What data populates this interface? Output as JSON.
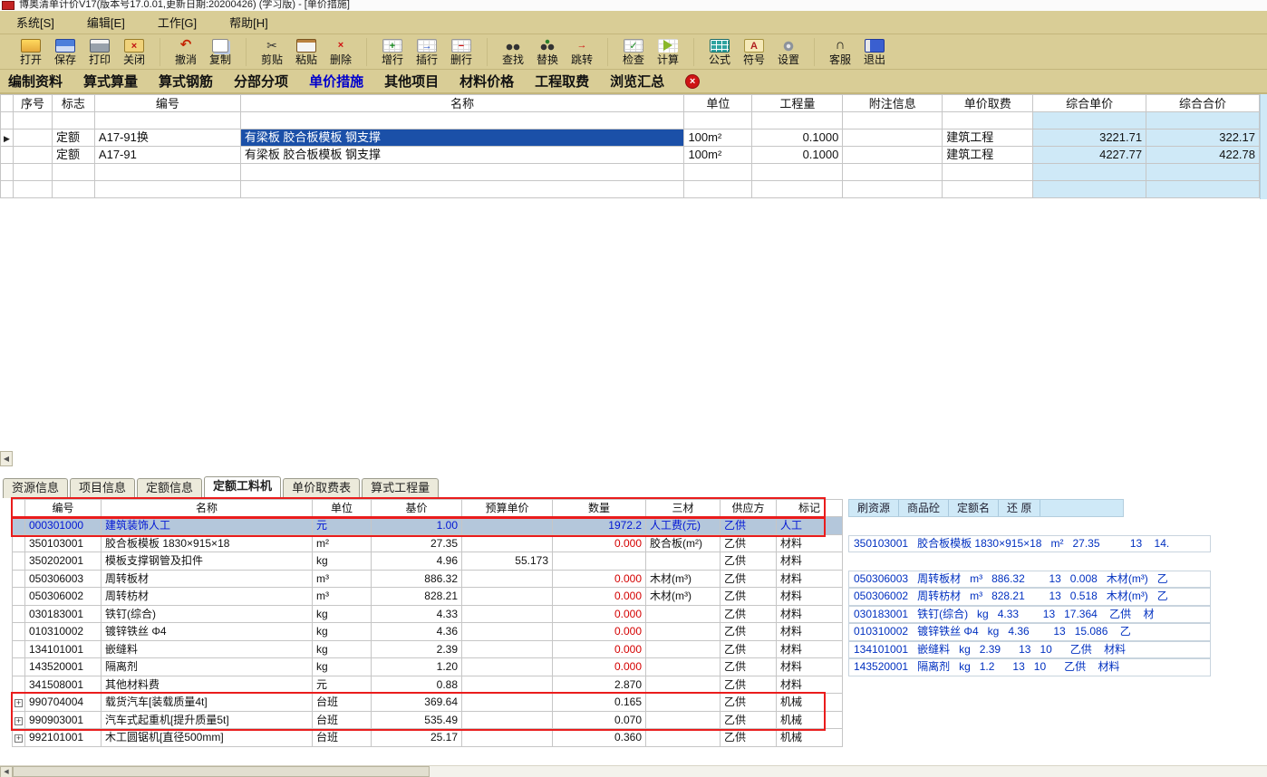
{
  "window": {
    "title": "博奥清单计价V17(版本号17.0.01,更新日期:20200426) (学习版) - [单价措施]"
  },
  "menu_bar": {
    "items": [
      "系统[S]",
      "编辑[E]",
      "工作[G]",
      "帮助[H]"
    ]
  },
  "toolbar": {
    "groups": {
      "file": [
        {
          "label": "打开",
          "icon": "open-folder-icon"
        },
        {
          "label": "保存",
          "icon": "save-floppy-icon"
        },
        {
          "label": "打印",
          "icon": "printer-icon"
        },
        {
          "label": "关闭",
          "icon": "close-door-icon"
        }
      ],
      "edit": [
        {
          "label": "撤消",
          "icon": "undo-arrow-icon"
        },
        {
          "label": "复制",
          "icon": "copy-icon"
        }
      ],
      "clipboard": [
        {
          "label": "剪贴",
          "icon": "scissors-icon"
        },
        {
          "label": "粘贴",
          "icon": "paste-clipboard-icon"
        },
        {
          "label": "删除",
          "icon": "delete-icon"
        }
      ],
      "rows": [
        {
          "label": "增行",
          "icon": "add-row-icon"
        },
        {
          "label": "插行",
          "icon": "insert-row-icon"
        },
        {
          "label": "删行",
          "icon": "delete-row-icon"
        }
      ],
      "search": [
        {
          "label": "查找",
          "icon": "find-icon"
        },
        {
          "label": "替换",
          "icon": "replace-icon"
        },
        {
          "label": "跳转",
          "icon": "goto-icon"
        }
      ],
      "calc": [
        {
          "label": "检查",
          "icon": "check-icon"
        },
        {
          "label": "计算",
          "icon": "calculate-icon"
        }
      ],
      "tools": [
        {
          "label": "公式",
          "icon": "formula-icon"
        },
        {
          "label": "符号",
          "icon": "symbol-icon"
        },
        {
          "label": "设置",
          "icon": "settings-icon"
        }
      ],
      "session": [
        {
          "label": "客服",
          "icon": "support-headset-icon"
        },
        {
          "label": "退出",
          "icon": "exit-icon"
        }
      ]
    }
  },
  "nav_tabs": {
    "items": [
      {
        "label": "编制资料",
        "active": false
      },
      {
        "label": "算式算量",
        "active": false
      },
      {
        "label": "算式钢筋",
        "active": false
      },
      {
        "label": "分部分项",
        "active": false
      },
      {
        "label": "单价措施",
        "active": true
      },
      {
        "label": "其他项目",
        "active": false
      },
      {
        "label": "材料价格",
        "active": false
      },
      {
        "label": "工程取费",
        "active": false
      },
      {
        "label": "浏览汇总",
        "active": false
      }
    ],
    "close_glyph": "×",
    "active_color": "#0000cc"
  },
  "upper_table": {
    "current_row_arrow": "▶",
    "columns": [
      "序号",
      "标志",
      "编号",
      "名称",
      "单位",
      "工程量",
      "附注信息",
      "单价取费",
      "综合单价",
      "综合合价"
    ],
    "highlight_column_color": "#cfe9f7",
    "rows": [
      {
        "seq": "",
        "flag": "",
        "code": "",
        "name": "",
        "unit": "",
        "qty": "",
        "note": "",
        "fee": "",
        "price": "",
        "total": "",
        "current": false,
        "name_selected": false
      },
      {
        "seq": "",
        "flag": "定额",
        "code": "A17-91换",
        "name": "有梁板 胶合板模板 钢支撑",
        "unit": "100m²",
        "qty": "0.1000",
        "note": "",
        "fee": "建筑工程",
        "price": "3221.71",
        "total": "322.17",
        "current": true,
        "name_selected": true
      },
      {
        "seq": "",
        "flag": "定额",
        "code": "A17-91",
        "name": "有梁板 胶合板模板 钢支撑",
        "unit": "100m²",
        "qty": "0.1000",
        "note": "",
        "fee": "建筑工程",
        "price": "4227.77",
        "total": "422.78",
        "current": false,
        "name_selected": false
      },
      {
        "seq": "",
        "flag": "",
        "code": "",
        "name": "",
        "unit": "",
        "qty": "",
        "note": "",
        "fee": "",
        "price": "",
        "total": "",
        "current": false,
        "name_selected": false
      },
      {
        "seq": "",
        "flag": "",
        "code": "",
        "name": "",
        "unit": "",
        "qty": "",
        "note": "",
        "fee": "",
        "price": "",
        "total": "",
        "current": false,
        "name_selected": false
      }
    ]
  },
  "detail_tabs": {
    "items": [
      {
        "label": "资源信息",
        "active": false
      },
      {
        "label": "项目信息",
        "active": false
      },
      {
        "label": "定额信息",
        "active": false
      },
      {
        "label": "定额工料机",
        "active": true
      },
      {
        "label": "单价取费表",
        "active": false
      },
      {
        "label": "算式工程量",
        "active": false
      }
    ]
  },
  "detail_table": {
    "expand_glyph": "+",
    "columns": [
      "编号",
      "名称",
      "单位",
      "基价",
      "预算单价",
      "数量",
      "三材",
      "供应方",
      "标记"
    ],
    "rows": [
      {
        "code": "000301000",
        "name": "建筑装饰人工",
        "unit": "元",
        "base": "1.00",
        "budget": "",
        "qty": "1972.2",
        "material": "人工费(元)",
        "supply": "乙供",
        "mark": "人工",
        "highlight": true,
        "qty_selected": true,
        "qty_red": false,
        "expandable": false
      },
      {
        "code": "350103001",
        "name": "胶合板模板 1830×915×18",
        "unit": "m²",
        "base": "27.35",
        "budget": "",
        "qty": "0.000",
        "material": "胶合板(m²)",
        "supply": "乙供",
        "mark": "材料",
        "highlight": false,
        "qty_selected": false,
        "qty_red": true,
        "expandable": false
      },
      {
        "code": "350202001",
        "name": "模板支撑钢管及扣件",
        "unit": "kg",
        "base": "4.96",
        "budget": "55.173",
        "qty": "",
        "material": "",
        "supply": "乙供",
        "mark": "材料",
        "highlight": false,
        "qty_selected": false,
        "qty_red": false,
        "expandable": false
      },
      {
        "code": "050306003",
        "name": "周转板材",
        "unit": "m³",
        "base": "886.32",
        "budget": "",
        "qty": "0.000",
        "material": "木材(m³)",
        "supply": "乙供",
        "mark": "材料",
        "highlight": false,
        "qty_selected": false,
        "qty_red": true,
        "expandable": false
      },
      {
        "code": "050306002",
        "name": "周转枋材",
        "unit": "m³",
        "base": "828.21",
        "budget": "",
        "qty": "0.000",
        "material": "木材(m³)",
        "supply": "乙供",
        "mark": "材料",
        "highlight": false,
        "qty_selected": false,
        "qty_red": true,
        "expandable": false
      },
      {
        "code": "030183001",
        "name": "铁钉(综合)",
        "unit": "kg",
        "base": "4.33",
        "budget": "",
        "qty": "0.000",
        "material": "",
        "supply": "乙供",
        "mark": "材料",
        "highlight": false,
        "qty_selected": false,
        "qty_red": true,
        "expandable": false
      },
      {
        "code": "010310002",
        "name": "镀锌铁丝 Φ4",
        "unit": "kg",
        "base": "4.36",
        "budget": "",
        "qty": "0.000",
        "material": "",
        "supply": "乙供",
        "mark": "材料",
        "highlight": false,
        "qty_selected": false,
        "qty_red": true,
        "expandable": false
      },
      {
        "code": "134101001",
        "name": "嵌缝料",
        "unit": "kg",
        "base": "2.39",
        "budget": "",
        "qty": "0.000",
        "material": "",
        "supply": "乙供",
        "mark": "材料",
        "highlight": false,
        "qty_selected": false,
        "qty_red": true,
        "expandable": false
      },
      {
        "code": "143520001",
        "name": "隔离剂",
        "unit": "kg",
        "base": "1.20",
        "budget": "",
        "qty": "0.000",
        "material": "",
        "supply": "乙供",
        "mark": "材料",
        "highlight": false,
        "qty_selected": false,
        "qty_red": true,
        "expandable": false
      },
      {
        "code": "341508001",
        "name": "其他材料费",
        "unit": "元",
        "base": "0.88",
        "budget": "",
        "qty": "2.870",
        "material": "",
        "supply": "乙供",
        "mark": "材料",
        "highlight": false,
        "qty_selected": false,
        "qty_red": false,
        "expandable": false
      },
      {
        "code": "990704004",
        "name": "载货汽车[装载质量4t]",
        "unit": "台班",
        "base": "369.64",
        "budget": "",
        "qty": "0.165",
        "material": "",
        "supply": "乙供",
        "mark": "机械",
        "highlight": false,
        "qty_selected": false,
        "qty_red": false,
        "expandable": true
      },
      {
        "code": "990903001",
        "name": "汽车式起重机[提升质量5t]",
        "unit": "台班",
        "base": "535.49",
        "budget": "",
        "qty": "0.070",
        "material": "",
        "supply": "乙供",
        "mark": "机械",
        "highlight": false,
        "qty_selected": false,
        "qty_red": false,
        "expandable": true
      },
      {
        "code": "992101001",
        "name": "木工圆锯机[直径500mm]",
        "unit": "台班",
        "base": "25.17",
        "budget": "",
        "qty": "0.360",
        "material": "",
        "supply": "乙供",
        "mark": "机械",
        "highlight": false,
        "qty_selected": false,
        "qty_red": false,
        "expandable": true
      }
    ]
  },
  "side_panel": {
    "buttons": [
      "刷资源",
      "商品砼",
      "定额名",
      "还 原"
    ],
    "rows": [
      {
        "align_row": 1,
        "text": "350103001   胶合板模板 1830×915×18   m²   27.35          13    14."
      },
      {
        "align_row": 3,
        "text": "050306003   周转板材   m³   886.32        13   0.008   木材(m³)   乙"
      },
      {
        "align_row": 4,
        "text": "050306002   周转枋材   m³   828.21        13   0.518   木材(m³)   乙"
      },
      {
        "align_row": 5,
        "text": "030183001   铁钉(综合)   kg   4.33        13   17.364    乙供    材"
      },
      {
        "align_row": 6,
        "text": "010310002   镀锌铁丝 Φ4   kg   4.36        13   15.086    乙"
      },
      {
        "align_row": 7,
        "text": "134101001   嵌缝料   kg   2.39      13   10      乙供    材料"
      },
      {
        "align_row": 8,
        "text": "143520001   隔离剂   kg   1.2      13   10      乙供    材料"
      }
    ]
  },
  "scrollbars": {
    "left_arrow": "◀",
    "annotation_color": "#ea1c1c"
  }
}
